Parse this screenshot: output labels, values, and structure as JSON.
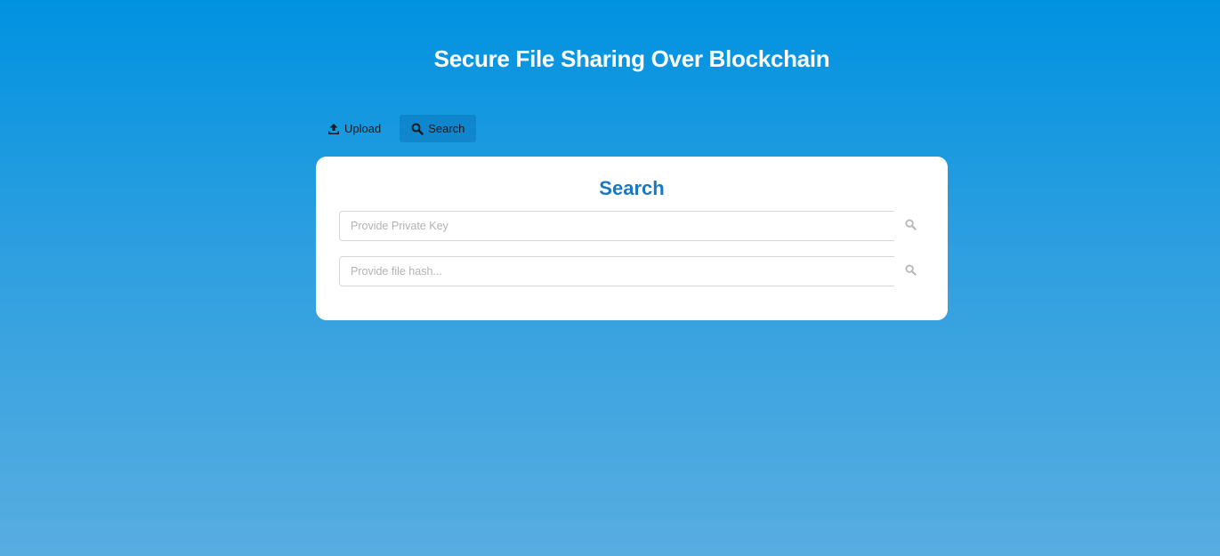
{
  "header": {
    "title": "Secure File Sharing Over Blockchain"
  },
  "tabs": [
    {
      "label": "Upload",
      "icon": "upload-icon",
      "active": false
    },
    {
      "label": "Search",
      "icon": "search-icon",
      "active": true
    }
  ],
  "search_card": {
    "title": "Search",
    "private_key": {
      "placeholder": "Provide Private Key",
      "value": ""
    },
    "file_hash": {
      "placeholder": "Provide file hash...",
      "value": ""
    }
  },
  "colors": {
    "background_top": "#0092e0",
    "background_bottom": "#58ade0",
    "accent": "#1a78c2",
    "card": "#ffffff"
  }
}
